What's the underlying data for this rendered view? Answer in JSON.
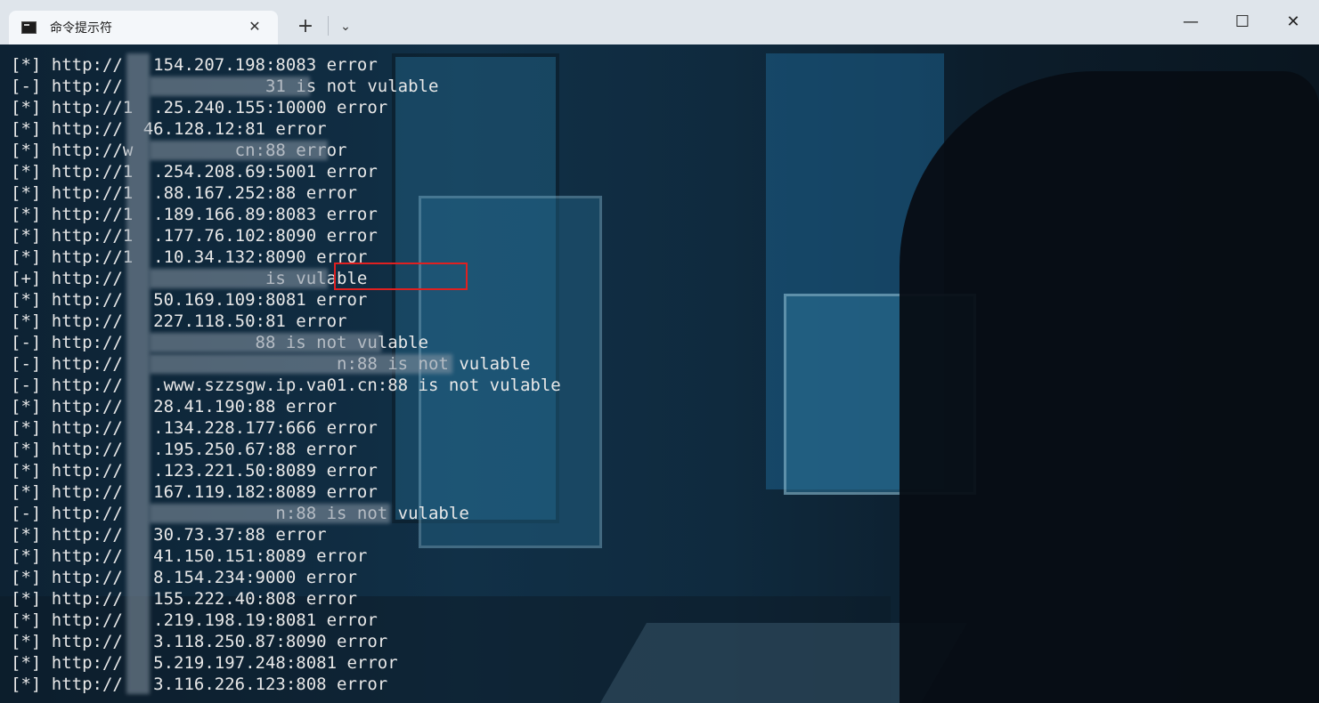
{
  "window": {
    "tab_title": "命令提示符",
    "tab_close": "✕",
    "new_tab": "+",
    "dropdown": "⌄",
    "minimize": "—",
    "maximize": "☐",
    "close": "✕"
  },
  "terminal": {
    "lines": [
      "[*] http://   154.207.198:8083 error",
      "[-] http://              31 is not vulable",
      "[*] http://1  .25.240.155:10000 error",
      "[*] http://  46.128.12:81 error",
      "[*] http://w          cn:88 error",
      "[*] http://1  .254.208.69:5001 error",
      "[*] http://1  .88.167.252:88 error",
      "[*] http://1  .189.166.89:8083 error",
      "[*] http://1  .177.76.102:8090 error",
      "[*] http://1  .10.34.132:8090 error",
      "[+] http://              is vulable",
      "[*] http://   50.169.109:8081 error",
      "[*] http://   227.118.50:81 error",
      "[-] http://             88 is not vulable",
      "[-] http://                     n:88 is not vulable",
      "[-] http://   .www.szzsgw.ip.va01.cn:88 is not vulable",
      "[*] http://   28.41.190:88 error",
      "[*] http://   .134.228.177:666 error",
      "[*] http://   .195.250.67:88 error",
      "[*] http://   .123.221.50:8089 error",
      "[*] http://   167.119.182:8089 error",
      "[-] http://               n:88 is not vulable",
      "[*] http://   30.73.37:88 error",
      "[*] http://   41.150.151:8089 error",
      "[*] http://   8.154.234:9000 error",
      "[*] http://   155.222.40:808 error",
      "[*] http://   .219.198.19:8081 error",
      "[*] http://   3.118.250.87:8090 error",
      "[*] http://   5.219.197.248:8081 error",
      "[*] http://   3.116.226.123:808 error"
    ]
  }
}
